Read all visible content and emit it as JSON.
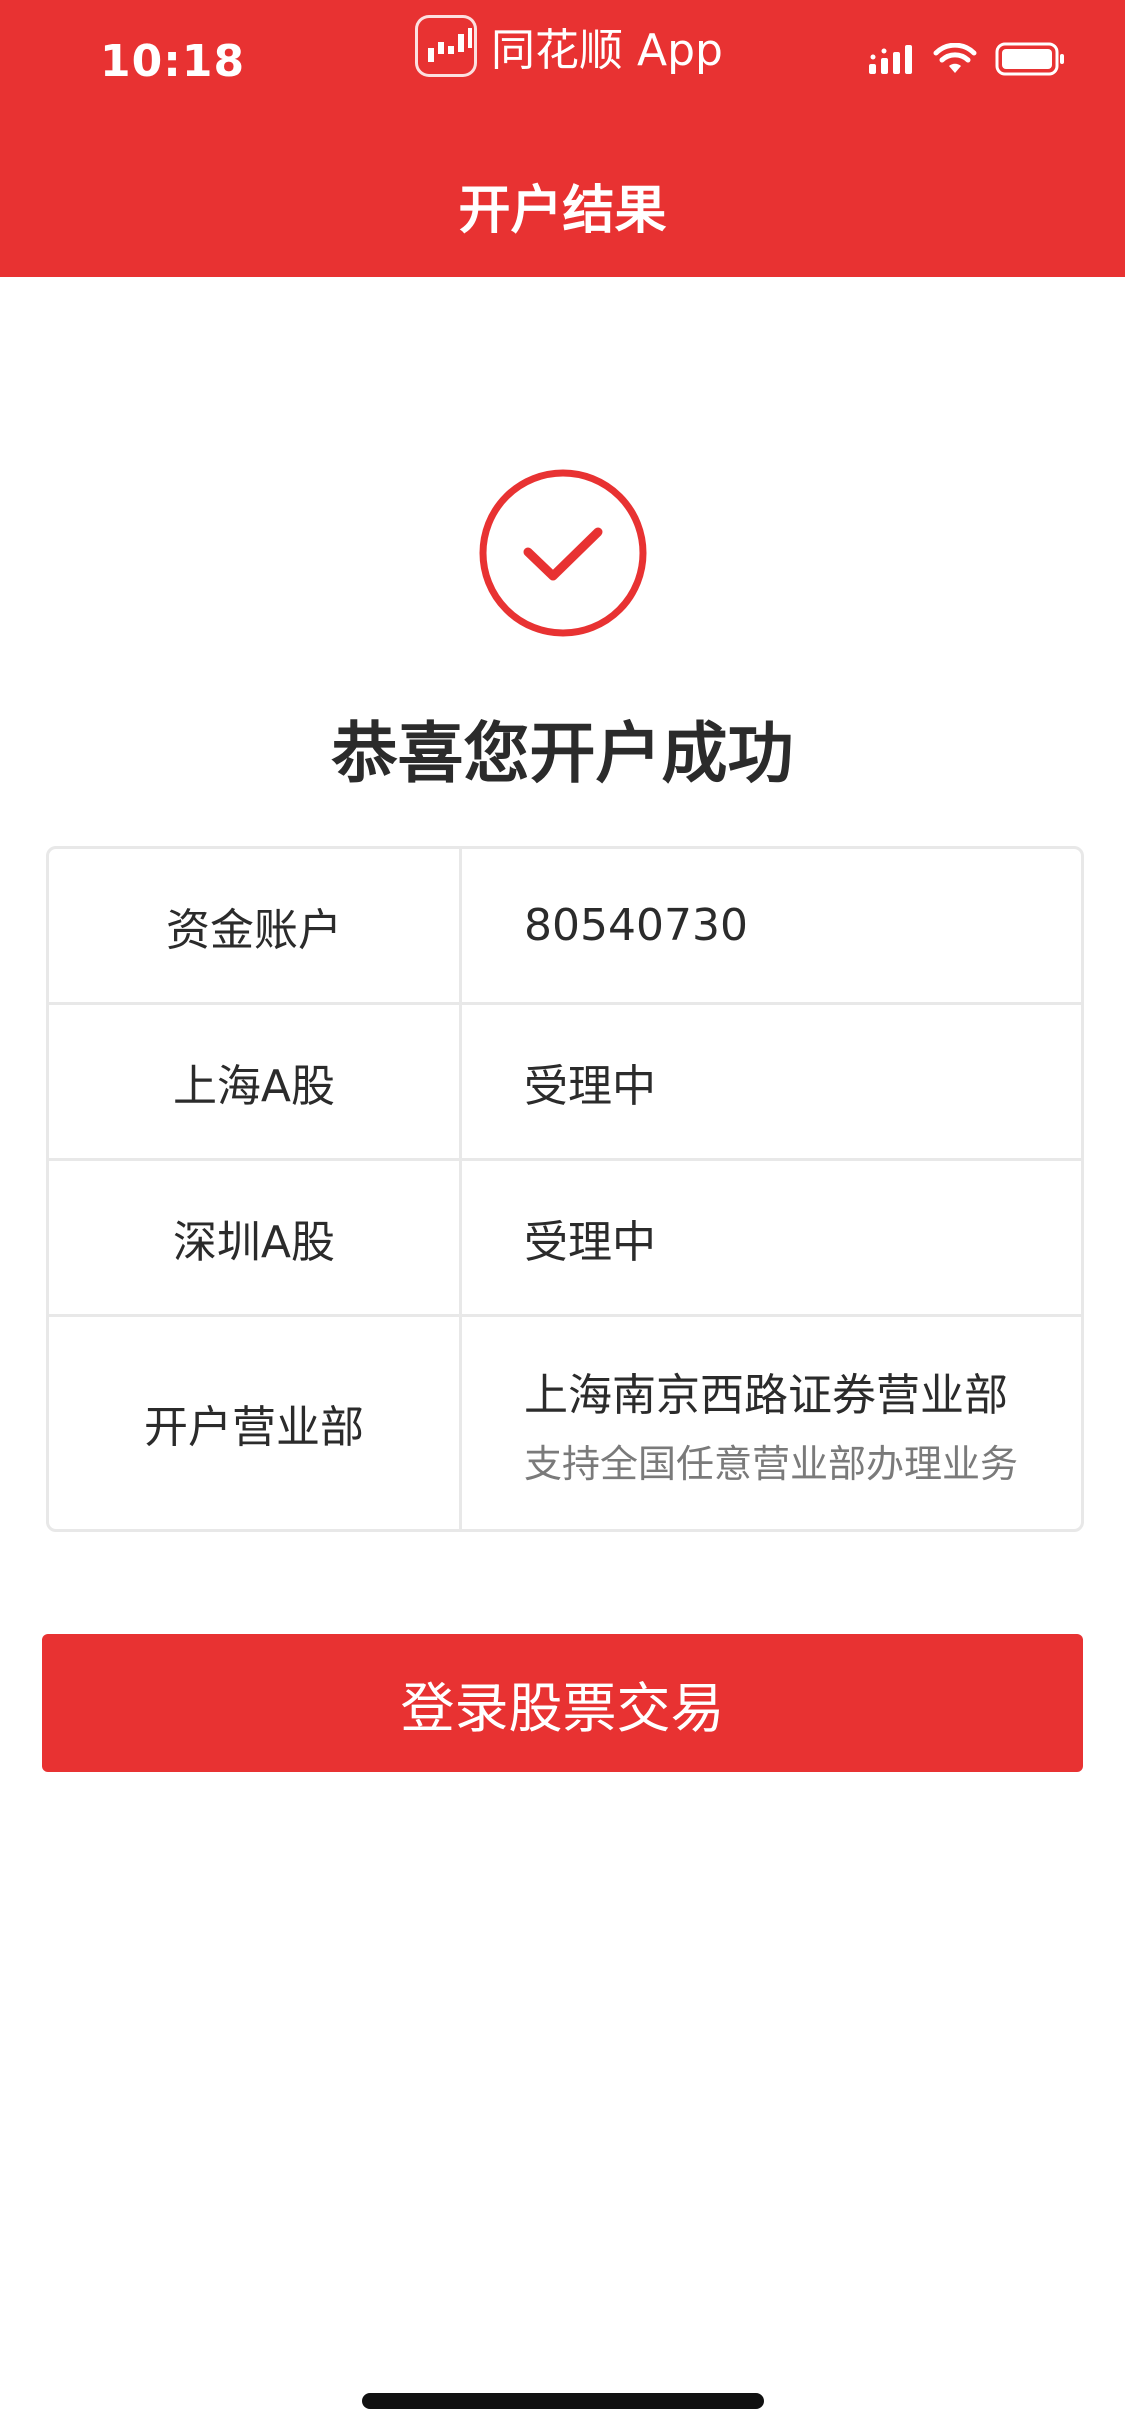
{
  "status_bar": {
    "time": "10:18",
    "source_app": "同花顺 App",
    "icons": [
      "cellular-signal-icon",
      "wifi-icon",
      "battery-icon"
    ]
  },
  "header": {
    "title": "开户结果"
  },
  "result": {
    "icon": "success-check-icon",
    "message": "恭喜您开户成功"
  },
  "table": {
    "rows": [
      {
        "label": "资金账户",
        "value": "80540730"
      },
      {
        "label": "上海A股",
        "value": "受理中"
      },
      {
        "label": "深圳A股",
        "value": "受理中"
      },
      {
        "label": "开户营业部",
        "value": "上海南京西路证券营业部",
        "sub_value": "支持全国任意营业部办理业务"
      }
    ]
  },
  "actions": {
    "login_label": "登录股票交易"
  },
  "colors": {
    "brand_red": "#e83232",
    "text_dark": "#2b2b2b",
    "text_muted": "#7a7a7a",
    "border": "#e8e8e8"
  }
}
